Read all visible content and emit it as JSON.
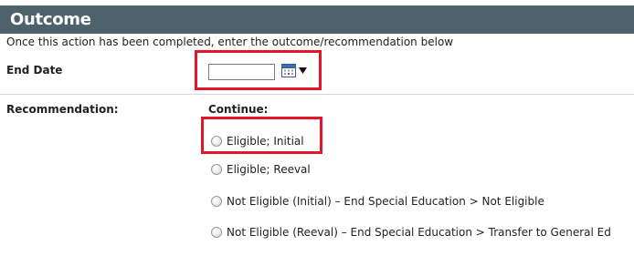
{
  "section": {
    "title": "Outcome",
    "instructions": "Once this action has been completed, enter the outcome/recommendation below"
  },
  "end_date": {
    "label": "End Date",
    "value": "",
    "calendar_icon": "calendar-icon",
    "dropdown_icon": "caret-down-icon"
  },
  "recommendation": {
    "label": "Recommendation:",
    "group_label": "Continue:",
    "options": [
      {
        "label": "Eligible; Initial",
        "selected": false
      },
      {
        "label": "Eligible; Reeval",
        "selected": false
      },
      {
        "label": "Not Eligible (Initial) – End Special Education > Not Eligible",
        "selected": false
      },
      {
        "label": "Not Eligible (Reeval) – End Special Education > Transfer to General Ed",
        "selected": false
      }
    ]
  },
  "colors": {
    "header_bg": "#4f616a",
    "highlight": "#e0162b"
  }
}
